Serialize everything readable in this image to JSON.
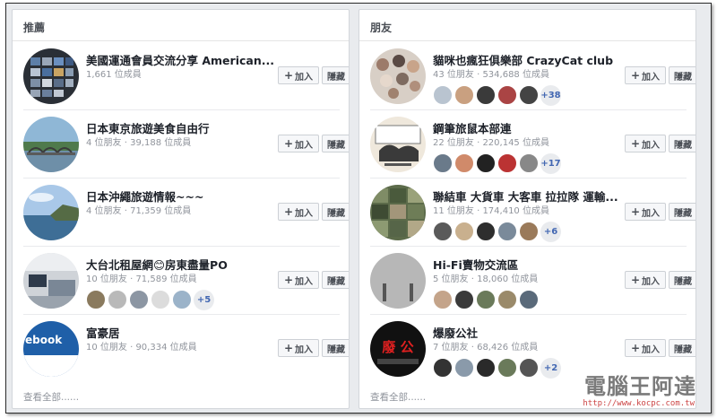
{
  "left": {
    "header": "推薦",
    "join_label": "加入",
    "hide_label": "隱藏",
    "footer": "查看全部......",
    "groups": [
      {
        "name": "美國運通會員交流分享 American...",
        "meta": "1,661 位成員"
      },
      {
        "name": "日本東京旅遊美食自由行",
        "meta": "4 位朋友 · 39,188 位成員"
      },
      {
        "name": "日本沖繩旅遊情報~~~",
        "meta": "4 位朋友 · 71,359 位成員"
      },
      {
        "name": "大台北租屋網😊房東盡量PO",
        "meta": "10 位朋友 · 71,589 位成員",
        "more": "+5"
      },
      {
        "name": "富豪居",
        "meta": "10 位朋友 · 90,334 位成員",
        "avatar_text": "ebook"
      }
    ]
  },
  "right": {
    "header": "朋友",
    "join_label": "加入",
    "hide_label": "隱藏",
    "footer": "查看全部......",
    "groups": [
      {
        "name": "貓咪也瘋狂俱樂部 CrazyCat club",
        "meta": "43 位朋友 · 534,688 位成員",
        "more": "+38"
      },
      {
        "name": "鋼筆旅鼠本部連",
        "meta": "22 位朋友 · 220,145 位成員",
        "more": "+17"
      },
      {
        "name": "聯結車 大貨車 大客車 拉拉隊 運輸...",
        "meta": "11 位朋友 · 174,410 位成員",
        "more": "+6"
      },
      {
        "name": "Hi-Fi賣物交流區",
        "meta": "5 位朋友 · 18,060 位成員"
      },
      {
        "name": "爆廢公社",
        "meta": "7 位朋友 · 68,426 位成員",
        "more": "+2",
        "avatar_text": "廢 公"
      }
    ]
  },
  "watermark": {
    "text": "電腦王阿達",
    "url": "http://www.kocpc.com.tw"
  },
  "colors": {
    "link": "#4267b2",
    "panel_bg": "#ffffff",
    "page_bg": "#e9ebee",
    "watermark_red": "#cc4444"
  }
}
